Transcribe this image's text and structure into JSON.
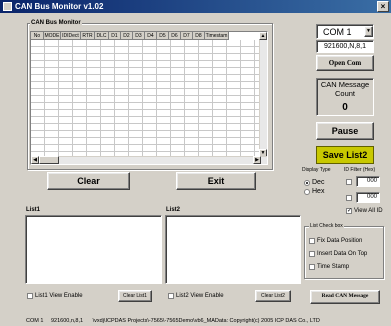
{
  "window": {
    "title": "CAN Bus Monitor v1.02",
    "close_glyph": "×"
  },
  "monitor": {
    "group_label": "CAN Bus Monitor",
    "columns": [
      "No",
      "MODE",
      "IDIDect",
      "RTR",
      "DLC",
      "D1",
      "D2",
      "D3",
      "D4",
      "D5",
      "D6",
      "D7",
      "D8",
      "Timestam"
    ]
  },
  "controls": {
    "com_port": "COM 1",
    "com_settings": "921600,N,8,1",
    "open_com": "Open Com",
    "msg_count_label": "CAN Message Count",
    "msg_count": "0",
    "pause": "Pause",
    "save_list2": "Save List2",
    "clear": "Clear",
    "exit": "Exit"
  },
  "display_type": {
    "label": "Display Type",
    "options": [
      "Dec",
      "Hex"
    ],
    "selected": "Dec"
  },
  "id_filter": {
    "label": "ID Filter (Hex)",
    "values": [
      "000",
      "000"
    ],
    "view_all": "View All ID"
  },
  "list_check": {
    "label": "List Check box",
    "options": [
      "Fix Data Position",
      "Insert Data On Top",
      "Time Stamp"
    ]
  },
  "list1": {
    "label": "List1",
    "view_enable": "List1 View Enable",
    "clear": "Clear List1"
  },
  "list2": {
    "label": "List2",
    "view_enable": "List2 View Enable",
    "clear": "Clear List2"
  },
  "read_can": "Read CAN Message",
  "status_bar": {
    "port": "COM 1",
    "settings": "921600,n,8,1",
    "path": "\\vxdj\\ICPDAS Projects\\-7565\\-7565Demo\\vb6_MAData: Copyright(c) 2005 ICP DAS Co., LTD"
  }
}
